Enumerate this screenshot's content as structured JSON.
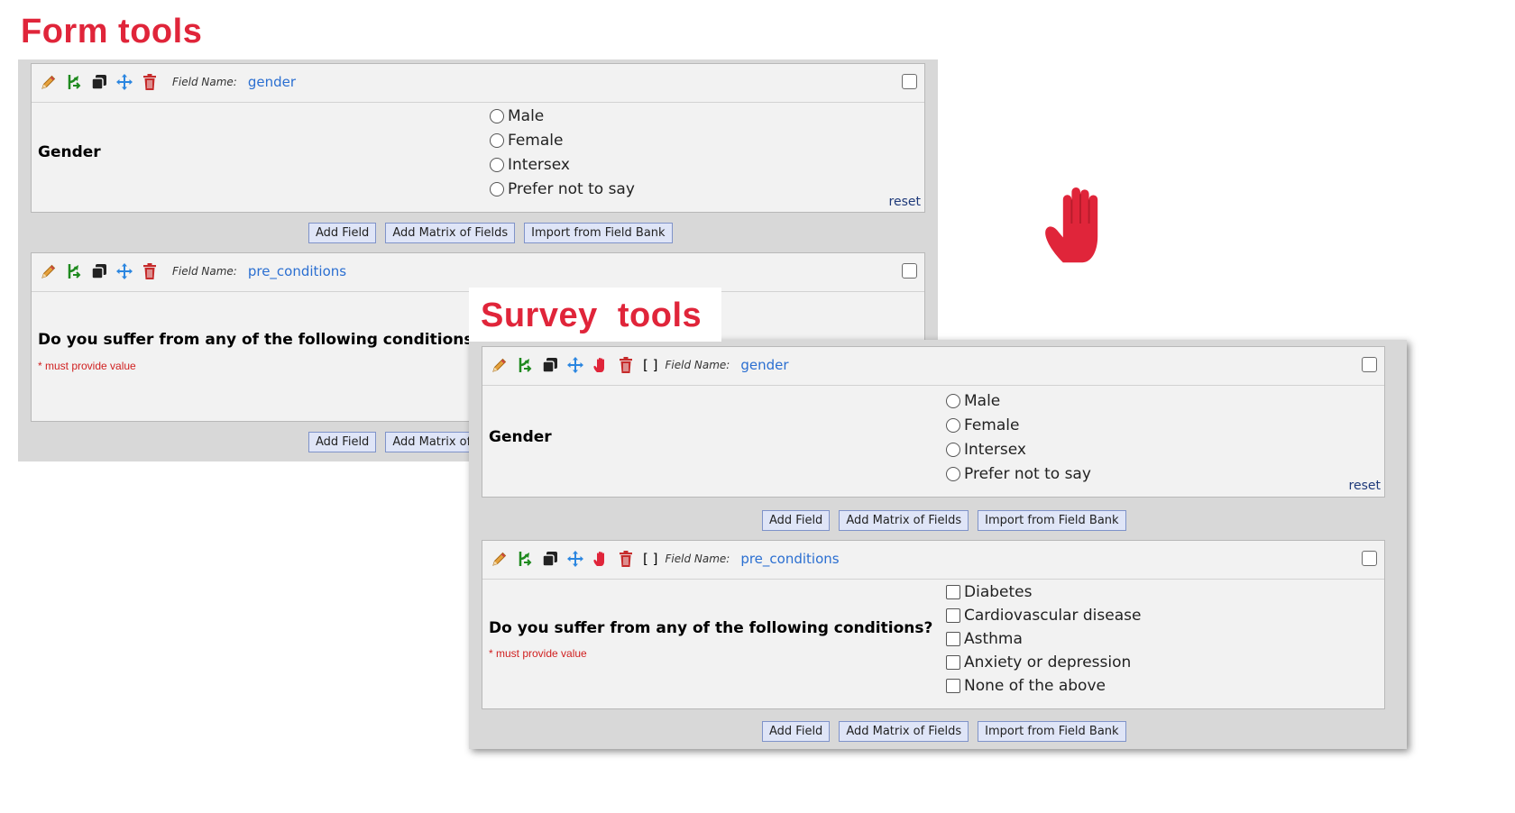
{
  "form_heading": "Form tools",
  "survey_heading": "Survey  tools",
  "field_name_label": "Field Name:",
  "bracket": "[ ]",
  "reset_label": "reset",
  "required_text": "* must provide value",
  "buttons": {
    "add_field": "Add Field",
    "add_matrix": "Add Matrix of Fields",
    "import_bank": "Import from Field Bank"
  },
  "fields": {
    "gender": {
      "name": "gender",
      "label": "Gender",
      "options": [
        "Male",
        "Female",
        "Intersex",
        "Prefer not to say"
      ]
    },
    "pre_conditions": {
      "name": "pre_conditions",
      "label": "Do you suffer from any of the following conditions?",
      "options": [
        "Diabetes",
        "Cardiovascular disease",
        "Asthma",
        "Anxiety or depression",
        "None of the above"
      ]
    }
  },
  "colors": {
    "heading": "#e0253a",
    "field_name_link": "#2b6fd1",
    "hand_icon": "#e0253a",
    "button_bg": "#dfe5f7"
  }
}
